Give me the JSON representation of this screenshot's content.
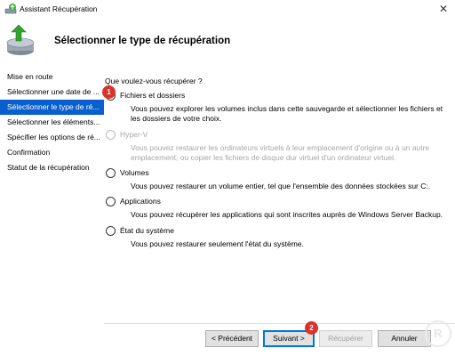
{
  "window": {
    "title": "Assistant Récupération",
    "close_glyph": "✕"
  },
  "header": {
    "title": "Sélectionner le type de récupération",
    "icon": "server-recovery-icon"
  },
  "nav": {
    "items": [
      {
        "label": "Mise en route",
        "state": "normal"
      },
      {
        "label": "Sélectionner une date de ...",
        "state": "normal"
      },
      {
        "label": "Sélectionner le type de ré...",
        "state": "active"
      },
      {
        "label": "Sélectionner les éléments...",
        "state": "dim"
      },
      {
        "label": "Spécifier les options de ré...",
        "state": "dim"
      },
      {
        "label": "Confirmation",
        "state": "dim"
      },
      {
        "label": "Statut de la récupération",
        "state": "dim"
      }
    ]
  },
  "main": {
    "question": "Que voulez-vous récupérer ?",
    "options": [
      {
        "label": "Fichiers et dossiers",
        "description": "Vous pouvez explorer les volumes inclus dans cette sauvegarde et sélectionner les fichiers et les dossiers de votre choix.",
        "checked": true,
        "disabled": false
      },
      {
        "label": "Hyper-V",
        "description": "Vous pouvez restaurer les ordinateurs virtuels à leur emplacement d'origine ou à un autre emplacement, ou copier les fichiers de disque dur virtuel d'un ordinateur virtuel.",
        "checked": false,
        "disabled": true
      },
      {
        "label": "Volumes",
        "description": "Vous pouvez restaurer un volume entier, tel que l'ensemble des données stockées sur C:.",
        "checked": false,
        "disabled": false
      },
      {
        "label": "Applications",
        "description": "Vous pouvez récupérer les applications qui sont inscrites auprès de Windows Server Backup.",
        "checked": false,
        "disabled": false
      },
      {
        "label": "État du système",
        "description": "Vous pouvez restaurer seulement l'état du système.",
        "checked": false,
        "disabled": false
      }
    ]
  },
  "footer": {
    "previous_label": "< Précédent",
    "next_label": "Suivant >",
    "recover_label": "Récupérer",
    "cancel_label": "Annuler"
  },
  "annotations": {
    "badge_1": "1",
    "badge_2": "2"
  },
  "colors": {
    "nav_active_bg": "#0a5fcf",
    "badge": "#d9342b",
    "primary_border": "#0078d7"
  }
}
